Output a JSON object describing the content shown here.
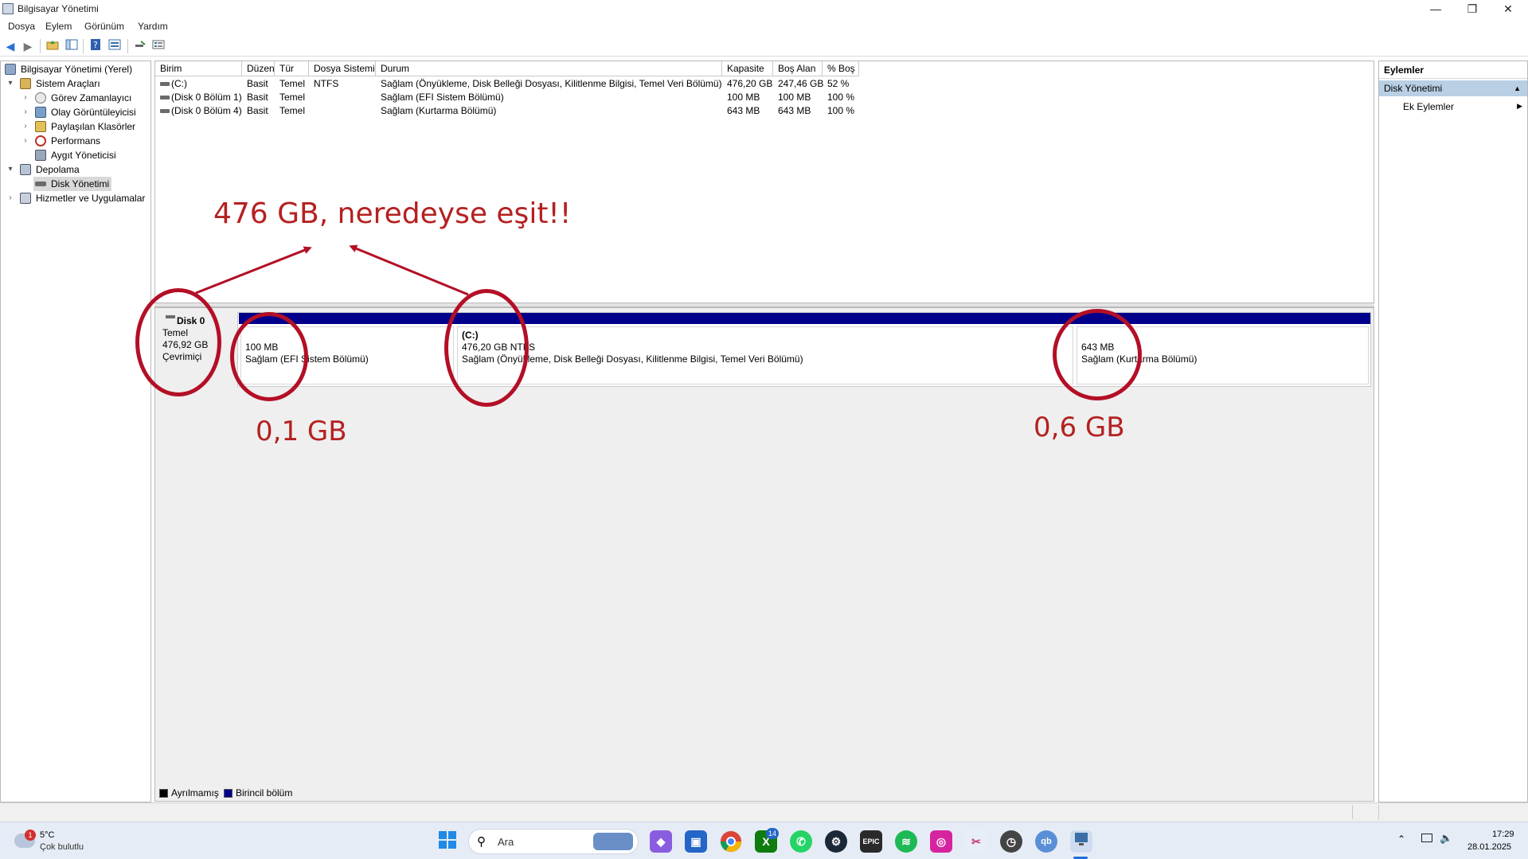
{
  "window": {
    "title": "Bilgisayar Yönetimi",
    "minimize": "—",
    "restore": "❐",
    "close": "✕"
  },
  "menu": [
    "Dosya",
    "Eylem",
    "Görünüm",
    "Yardım"
  ],
  "toolbar": {
    "icons": [
      "back-arrow-icon",
      "forward-arrow-icon",
      "up-folder-icon",
      "show-hide-tree-icon",
      "help-icon",
      "properties-icon",
      "connect-icon",
      "list-icon"
    ]
  },
  "tree": [
    {
      "label": "Bilgisayar Yönetimi (Yerel)",
      "icon": "computer-icon",
      "expanded": null
    },
    {
      "label": "Sistem Araçları",
      "icon": "tools-icon",
      "expanded": "▾"
    },
    {
      "label": "Görev Zamanlayıcı",
      "icon": "clock-icon",
      "expanded": "›"
    },
    {
      "label": "Olay Görüntüleyicisi",
      "icon": "event-icon",
      "expanded": "›"
    },
    {
      "label": "Paylaşılan Klasörler",
      "icon": "share-folder-icon",
      "expanded": "›"
    },
    {
      "label": "Performans",
      "icon": "performance-icon",
      "expanded": "›"
    },
    {
      "label": "Aygıt Yöneticisi",
      "icon": "device-icon",
      "expanded": null
    },
    {
      "label": "Depolama",
      "icon": "storage-icon",
      "expanded": "▾"
    },
    {
      "label": "Disk Yönetimi",
      "icon": "disk-icon",
      "expanded": null
    },
    {
      "label": "Hizmetler ve Uygulamalar",
      "icon": "services-icon",
      "expanded": "›"
    }
  ],
  "volumes": {
    "columns": [
      "Birim",
      "Düzen",
      "Tür",
      "Dosya Sistemi",
      "Durum",
      "Kapasite",
      "Boş Alan",
      "% Boş"
    ],
    "rows": [
      [
        "(C:)",
        "Basit",
        "Temel",
        "NTFS",
        "Sağlam (Önyükleme, Disk Belleği Dosyası, Kilitlenme Bilgisi, Temel Veri Bölümü)",
        "476,20 GB",
        "247,46 GB",
        "52 %"
      ],
      [
        "(Disk 0 Bölüm 1)",
        "Basit",
        "Temel",
        "",
        "Sağlam (EFI Sistem Bölümü)",
        "100 MB",
        "100 MB",
        "100 %"
      ],
      [
        "(Disk 0 Bölüm 4)",
        "Basit",
        "Temel",
        "",
        "Sağlam (Kurtarma Bölümü)",
        "643 MB",
        "643 MB",
        "100 %"
      ]
    ]
  },
  "disk": {
    "name": "Disk 0",
    "type": "Temel",
    "size": "476,92 GB",
    "status": "Çevrimiçi",
    "partitions": [
      {
        "title": "",
        "size": "100 MB",
        "status": "Sağlam (EFI Sistem Bölümü)"
      },
      {
        "title": "(C:)",
        "size": "476,20 GB NTFS",
        "status": "Sağlam (Önyükleme, Disk Belleği Dosyası, Kilitlenme Bilgisi, Temel Veri Bölümü)"
      },
      {
        "title": "",
        "size": "643 MB",
        "status": "Sağlam (Kurtarma Bölümü)"
      }
    ]
  },
  "legend": [
    {
      "label": "Ayrılmamış",
      "color": "#000000"
    },
    {
      "label": "Birincil bölüm",
      "color": "#00008b"
    }
  ],
  "actions": {
    "header": "Eylemler",
    "section": "Disk Yönetimi",
    "item": "Ek Eylemler"
  },
  "annotations": {
    "headline": "476 GB, neredeyse eşit!!",
    "efi_note": "0,1 GB",
    "recovery_note": "0,6 GB",
    "color": "#b52020"
  },
  "taskbar": {
    "weather_temp": "5°C",
    "weather_desc": "Çok bulutlu",
    "weather_badge": "1",
    "search_placeholder": "Ara",
    "xbox_badge": "14",
    "time": "17:29",
    "date": "28.01.2025"
  }
}
